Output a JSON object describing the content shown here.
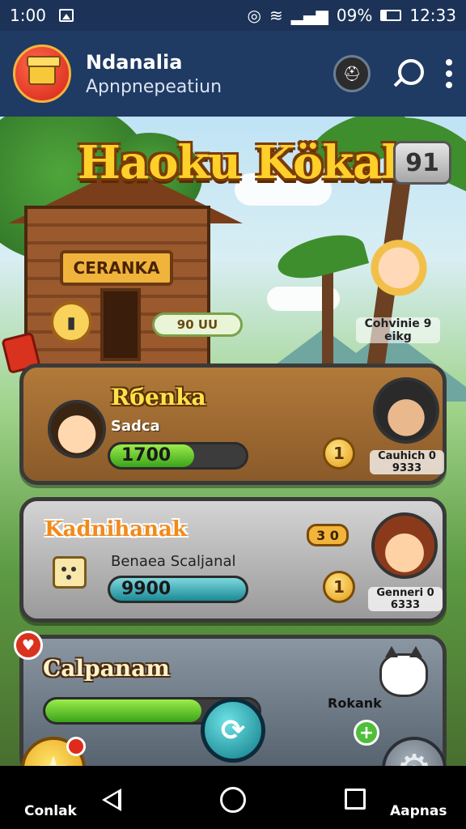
{
  "status_bar": {
    "time_left": "1:00",
    "battery_text": "09%",
    "time_right": "12:33"
  },
  "app_bar": {
    "title": "Ndanalia",
    "subtitle": "Apnpnepeatiun"
  },
  "game": {
    "title": "Haoku Kökak",
    "level_badge": "91",
    "house_sign": "CERANKA",
    "pill_tag": "90 UU",
    "npc_top_label": "Cohvinie 9 eikg",
    "cards": [
      {
        "title": "Rбenka",
        "subtitle": "Sadca",
        "bar_value": "1700",
        "bar_fill": 0.62,
        "coin": "1",
        "npc_label": "Cauhich 0 9333"
      },
      {
        "title": "Kadnihanak",
        "subtitle": "Benaea Scaljanal",
        "bar_value": "9900",
        "bar_fill": 1.0,
        "coin": "1",
        "mini_pill": "3 0",
        "npc_label": "Genneri 0 6333"
      },
      {
        "title": "Calpanam",
        "side_label": "Rokank",
        "bar_fill": 0.73
      }
    ]
  },
  "bottom": {
    "left_label": "Conlak",
    "right_label": "Aapnas"
  },
  "colors": {
    "status_bar": "#1c3357",
    "app_bar": "#1f3a63",
    "title_gold": "#ffcf2a",
    "bar_green": "#3aa31a",
    "bar_teal": "#1a8a96"
  }
}
